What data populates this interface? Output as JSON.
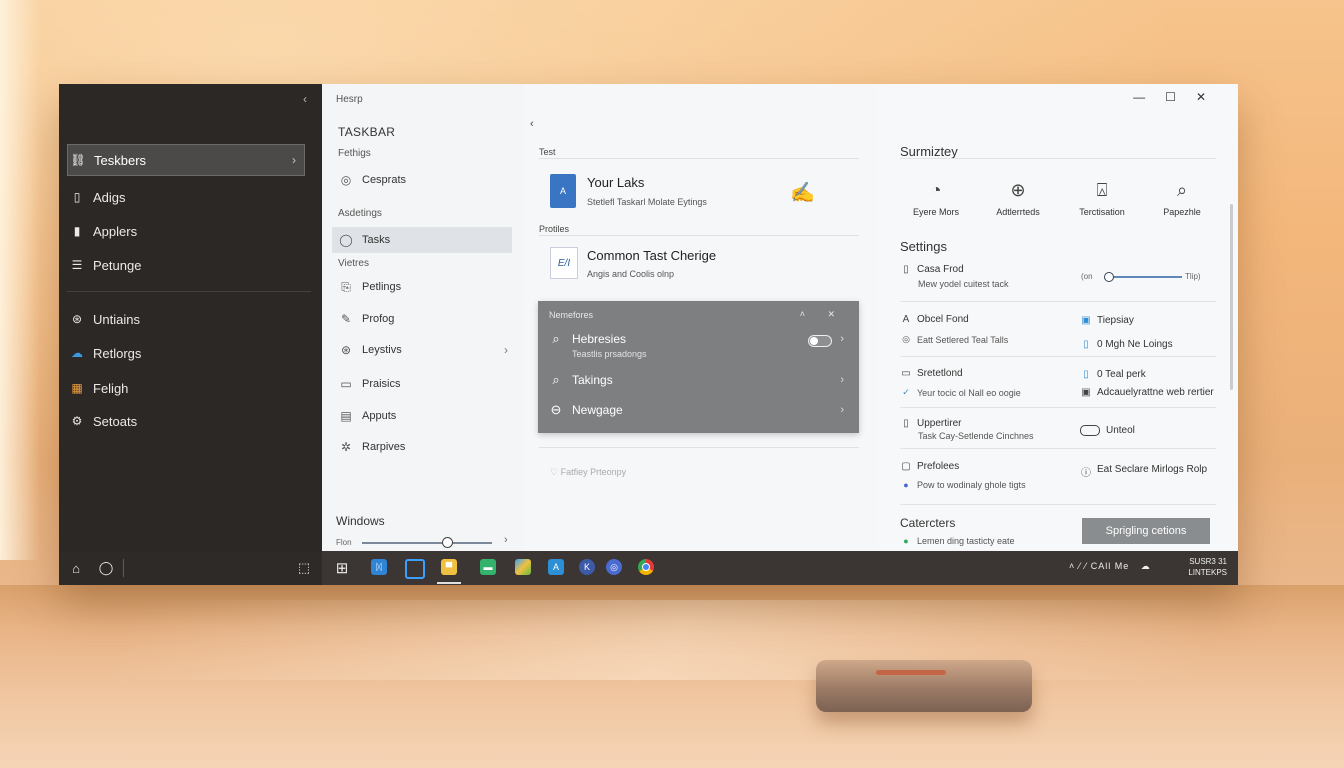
{
  "window": {
    "title": "Hesrp",
    "controls": {
      "minimize": "—",
      "maximize": "☐",
      "close": "✕"
    }
  },
  "sidebar": {
    "collapse_glyph": "‹",
    "items": [
      {
        "label": "Teskbers",
        "icon": "taskbar-icon",
        "glyph": "⛓",
        "active": true,
        "chevron": "›"
      },
      {
        "label": "Adigs",
        "icon": "app-icon",
        "glyph": "▯"
      },
      {
        "label": "Applers",
        "icon": "apps-icon",
        "glyph": "▮"
      },
      {
        "label": "Petunge",
        "icon": "settings-list-icon",
        "glyph": "☰"
      },
      {
        "label": "Untiains",
        "icon": "globe-icon",
        "glyph": "⊛"
      },
      {
        "label": "Retlorgs",
        "icon": "cloud-icon",
        "glyph": "☁"
      },
      {
        "label": "Feligh",
        "icon": "windows-grid-icon",
        "glyph": "▦"
      },
      {
        "label": "Setoats",
        "icon": "gear-icon",
        "glyph": "⚙"
      }
    ]
  },
  "middle": {
    "header": "TASKBAR",
    "group1": "Fethigs",
    "group2": "Asdetings",
    "group3": "Vietres",
    "items": [
      {
        "label": "Cesprats",
        "glyph": "◎"
      },
      {
        "label": "Tasks",
        "glyph": "◯",
        "active": true
      },
      {
        "label": "Petlings",
        "glyph": "⎘"
      },
      {
        "label": "Profog",
        "glyph": "✎"
      },
      {
        "label": "Leystivs",
        "glyph": "⊛",
        "chevron": "›"
      },
      {
        "label": "Praisics",
        "glyph": "▭"
      },
      {
        "label": "Apputs",
        "glyph": "▤"
      },
      {
        "label": "Rarpives",
        "glyph": "✲"
      }
    ],
    "footer_title": "Windows",
    "slider_label": "Flon",
    "slider_chevron": "›"
  },
  "center": {
    "back_glyph": "‹",
    "label1": "Test",
    "card1": {
      "title": "Your Laks",
      "subtitle": "Stetlefl Taskarl Molate Eytings",
      "icon_text": "A"
    },
    "label2": "Protiles",
    "card2": {
      "title": "Common Tast Cherige",
      "subtitle": "Angis and Coolis olnp",
      "icon_text": "E/I"
    },
    "notification": {
      "header": "Nemefores",
      "controls": "˄ ✕",
      "rows": [
        {
          "label": "Hebresies",
          "sub": "Teastlis prsadongs",
          "glyph": "⌕"
        },
        {
          "label": "Takings",
          "glyph": "⌕"
        },
        {
          "label": "Newgage",
          "glyph": "⊖"
        }
      ],
      "chevron": "›"
    },
    "faded": "♡   Fatfiey Prteonpy"
  },
  "summary": {
    "title": "Surmiztey",
    "items": [
      {
        "label": "Eyere Mors",
        "glyph": "◔"
      },
      {
        "label": "Adtlerrteds",
        "glyph": "⊕"
      },
      {
        "label": "Terctisation",
        "glyph": "⍓"
      },
      {
        "label": "Papezhle",
        "glyph": "⌕"
      }
    ],
    "settings_title": "Settings",
    "rows": [
      {
        "title": "Casa Frod",
        "sub": "Mew yodel cuitest tack",
        "glyph": "▯"
      },
      {
        "title": "Obcel Fond",
        "sub": "Eatt Setlered Teal Talls",
        "glyph": "A",
        "sub_glyph": "◎"
      },
      {
        "title": "Sretetlond",
        "sub": "Yeur tocic ol Nall eo oogie",
        "glyph": "▭",
        "sub_glyph": "✓"
      },
      {
        "title": "Uppertirer",
        "sub": "Task Cay-Setlende Cinchnes",
        "glyph": "▯"
      },
      {
        "title": "Prefolees",
        "sub": "Pow to wodinaly ghole tigts",
        "glyph": "▢",
        "sub_glyph": "●"
      }
    ],
    "slider": {
      "left_label": "(on",
      "right_label": "Tlip)"
    },
    "right_items": [
      {
        "label": "Tiepsiay",
        "glyph": "▣"
      },
      {
        "label": "0 Mgh Ne Loings",
        "glyph": "▯"
      },
      {
        "label": "0 Teal perk",
        "glyph": "▯"
      },
      {
        "label": "Adcauelyrattne web rertier",
        "glyph": "▣"
      },
      {
        "label": "Unteol"
      },
      {
        "label": "Eat Seclare Mirlogs Rolp",
        "glyph": "ⓘ"
      }
    ],
    "categories_title": "Catercters",
    "categories_sub": "Lemen ding tasticty eate",
    "button": "Sprigling cetions"
  },
  "taskbar": {
    "tray_text": "˄  ⁄  ⁄  CAll Me",
    "clock_line1": "SUSR3 31",
    "clock_line2": "LINTEKPS",
    "apps": [
      {
        "name": "start",
        "color": "#ffffff"
      },
      {
        "name": "edge-ish",
        "color": "#2f84d6"
      },
      {
        "name": "window",
        "color": "#3aa0ff"
      },
      {
        "name": "explorer",
        "color": "#f0c040"
      },
      {
        "name": "chat",
        "color": "#35b36c"
      },
      {
        "name": "colorful",
        "color": "#66bb44"
      },
      {
        "name": "store",
        "color": "#2d8fd6"
      },
      {
        "name": "k-app",
        "color": "#3d5aa8"
      },
      {
        "name": "globe",
        "color": "#4a6bd0"
      },
      {
        "name": "chrome",
        "color": "#e8b020"
      }
    ]
  },
  "colors": {
    "sidebar_bg": "#2b2826",
    "taskbar_bg": "#3b3633",
    "notification_bg": "#7d7f81",
    "accent": "#3a75c4",
    "wall": "#f3b77b"
  }
}
